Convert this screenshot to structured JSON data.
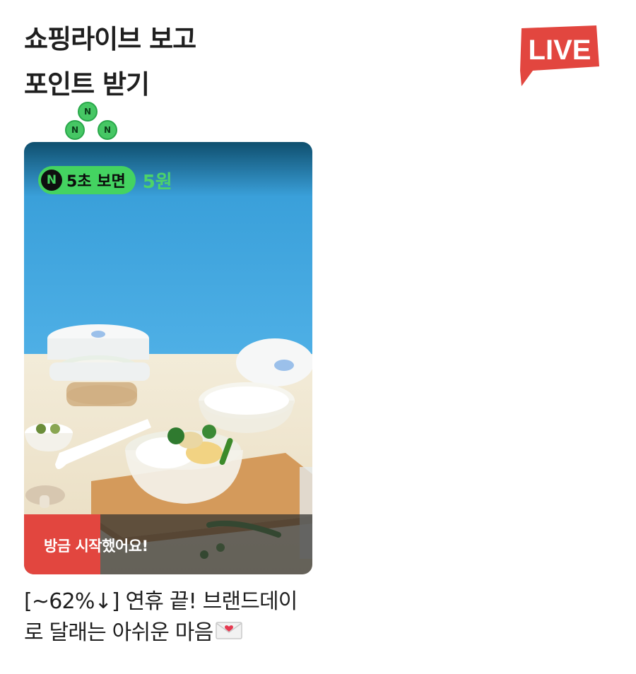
{
  "headline": {
    "line1": "쇼핑라이브 보고",
    "line2": "포인트 받기"
  },
  "live_badge": {
    "label": "LIVE",
    "color": "#e2463f"
  },
  "coin_icons": [
    {
      "icon": "naver-pay-coin-icon",
      "label": "N"
    },
    {
      "icon": "naver-pay-coin-icon",
      "label": "N"
    },
    {
      "icon": "naver-pay-coin-icon",
      "label": "N"
    }
  ],
  "card": {
    "reward": {
      "icon_label": "N",
      "condition": "5초 보면",
      "amount": "5원",
      "accent": "#44d361"
    },
    "status": "방금 시작했어요!",
    "status_color": "#e2463f"
  },
  "product": {
    "title_line1": "[~62%↓] 연휴 끝! 브랜드데이",
    "title_line2": "로 달래는 아쉬운 마음",
    "emoji_icon": "love-letter-icon"
  }
}
